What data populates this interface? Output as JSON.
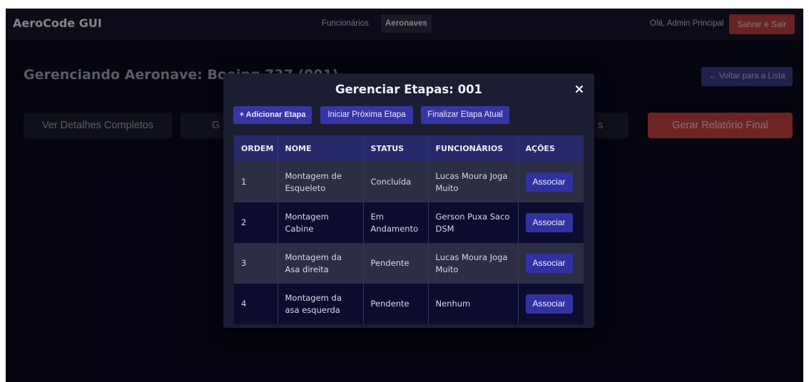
{
  "app": {
    "title": "AeroCode GUI"
  },
  "nav": {
    "items": [
      {
        "label": "Funcionários",
        "active": false
      },
      {
        "label": "Aeronaves",
        "active": true
      }
    ],
    "greeting": "Olá, Admin Principal",
    "exit_label": "Salvar e Sair"
  },
  "page": {
    "title": "Gerenciando Aeronave: Boeing 737 (001)",
    "back_label": "← Voltar para a Lista",
    "actions": [
      {
        "label": "Ver Detalhes Completos"
      },
      {
        "label": "G"
      },
      {
        "label": "s"
      },
      {
        "label": "Gerar Relatório Final"
      }
    ]
  },
  "modal": {
    "title": "Gerenciar Etapas: 001",
    "close_icon": "close-icon",
    "buttons": {
      "add": "+ Adicionar Etapa",
      "start_next": "Iniciar Próxima Etapa",
      "finish_current": "Finalizar Etapa Atual"
    },
    "table": {
      "headers": [
        "ORDEM",
        "NOME",
        "STATUS",
        "FUNCIONÁRIOS",
        "AÇÕES"
      ],
      "rows": [
        {
          "ordem": "1",
          "nome": "Montagem de Esqueleto",
          "status": "Concluída",
          "funcionarios": "Lucas Moura Joga Muito",
          "acao": "Associar"
        },
        {
          "ordem": "2",
          "nome": "Montagem Cabine",
          "status": "Em Andamento",
          "funcionarios": "Gerson Puxa Saco DSM",
          "acao": "Associar"
        },
        {
          "ordem": "3",
          "nome": "Montagem da Asa direita",
          "status": "Pendente",
          "funcionarios": "Lucas Moura Joga Muito",
          "acao": "Associar"
        },
        {
          "ordem": "4",
          "nome": "Montagem da asa esquerda",
          "status": "Pendente",
          "funcionarios": "Nenhum",
          "acao": "Associar"
        }
      ]
    }
  },
  "colors": {
    "background": "#080a1d",
    "topbar": "#15172b",
    "accent": "#3536a6",
    "danger": "#c0403e",
    "table_header": "#28296a"
  }
}
